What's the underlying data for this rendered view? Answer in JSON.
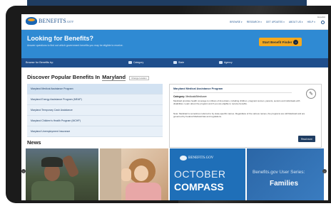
{
  "header": {
    "logo_text": "BENEFITS",
    "logo_suffix": ".GOV",
    "nav": [
      "BROWSE ▾",
      "RESEARCH ▾",
      "GET UPDATES ▾",
      "ABOUT US ▾",
      "HELP ▾"
    ],
    "lang": "Español"
  },
  "hero": {
    "title": "Looking for Benefits?",
    "subtitle": "Answer questions to find out which government benefits you may be eligible to receive.",
    "button_label": "Start Benefit Finder"
  },
  "browse": {
    "label": "Browse for Benefits by:",
    "items": [
      "Category",
      "State",
      "Agency"
    ]
  },
  "discover": {
    "title": "Discover Popular Benefits In",
    "state": "Maryland",
    "change_label": "Change location"
  },
  "benefits": [
    "Maryland Medical Assistance Program",
    "Maryland Energy Assistance Program (MEAP)",
    "Maryland Temporary Cash Assistance",
    "Maryland Children's Health Program (MCHP)",
    "Maryland Unemployment Insurance"
  ],
  "detail": {
    "title": "Maryland Medical Assistance Program",
    "category_label": "Category:",
    "category_value": "Medicaid/Medicare",
    "body": "Medicaid provides health coverage to millions of Americans, including children, pregnant women, parents, seniors and individuals with disabilities. Learn about the program and if you are eligible to receive benefits.",
    "note": "Note: Medicaid is sometimes referred to by state-specific names. Regardless of the various names, the programs are still Medicaid and are governed by Federal Medicaid law and regulations.",
    "button_label": "Read more"
  },
  "news": {
    "title": "News",
    "tile3_logo": "BENEFITS.GOV",
    "tile3_line1": "OCTOBER",
    "tile3_line2": "COMPASS",
    "tile4_line1": "Benefits.gov User Series:",
    "tile4_line2": "Families"
  },
  "colors": {
    "brand_blue": "#1f4e8c",
    "hero_blue": "#2f8ad3",
    "accent_orange": "#f5a91f"
  }
}
